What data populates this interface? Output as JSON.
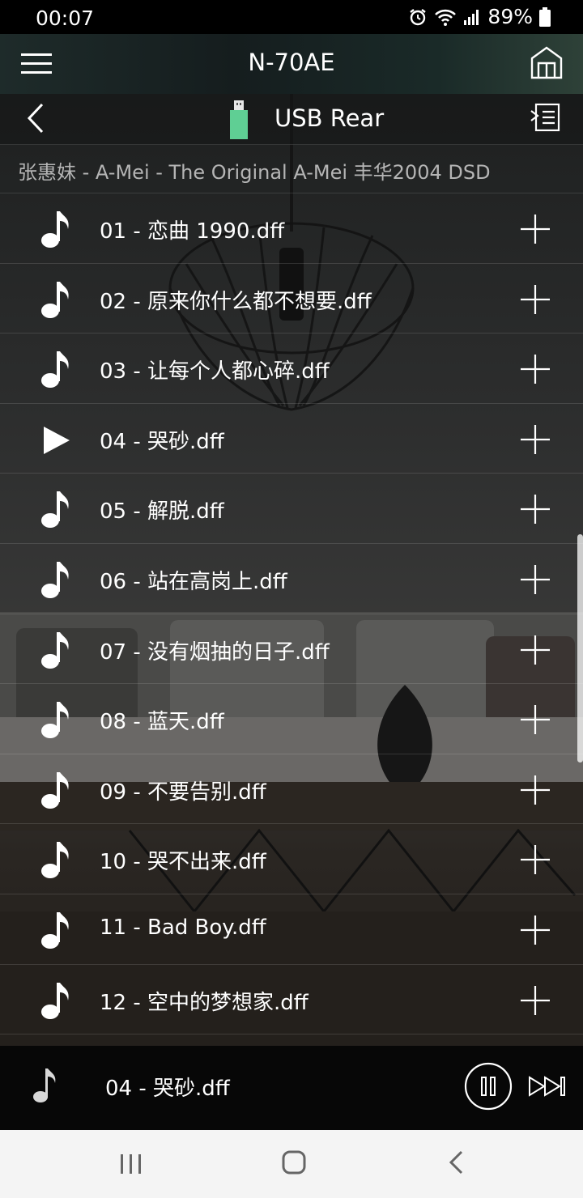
{
  "status_bar": {
    "time": "00:07",
    "battery": "89%",
    "icons": [
      "alarm-icon",
      "wifi-icon",
      "signal-icon",
      "battery-icon"
    ]
  },
  "header": {
    "title": "N-70AE",
    "menu_icon": "hamburger-menu-icon",
    "home_icon": "home-icon"
  },
  "source": {
    "label": "USB Rear",
    "icon": "usb-stick-icon",
    "usb_color": "#5fcf94"
  },
  "album": {
    "title": "张惠妹 - A-Mei - The Original A-Mei 丰华2004 DSD"
  },
  "tracks": [
    {
      "name": "01 - 恋曲 1990.dff",
      "playing": false
    },
    {
      "name": "02 - 原来你什么都不想要.dff",
      "playing": false
    },
    {
      "name": "03 - 让每个人都心碎.dff",
      "playing": false
    },
    {
      "name": "04 - 哭砂.dff",
      "playing": true
    },
    {
      "name": "05 - 解脱.dff",
      "playing": false
    },
    {
      "name": "06 - 站在高岗上.dff",
      "playing": false
    },
    {
      "name": "07 - 没有烟抽的日子.dff",
      "playing": false
    },
    {
      "name": "08 - 蓝天.dff",
      "playing": false
    },
    {
      "name": "09 - 不要告别.dff",
      "playing": false
    },
    {
      "name": "10 - 哭不出来.dff",
      "playing": false
    },
    {
      "name": "11 - Bad Boy.dff",
      "playing": false
    },
    {
      "name": "12 - 空中的梦想家.dff",
      "playing": false
    }
  ],
  "now_playing": {
    "title": "04 - 哭砂.dff",
    "state": "playing"
  }
}
